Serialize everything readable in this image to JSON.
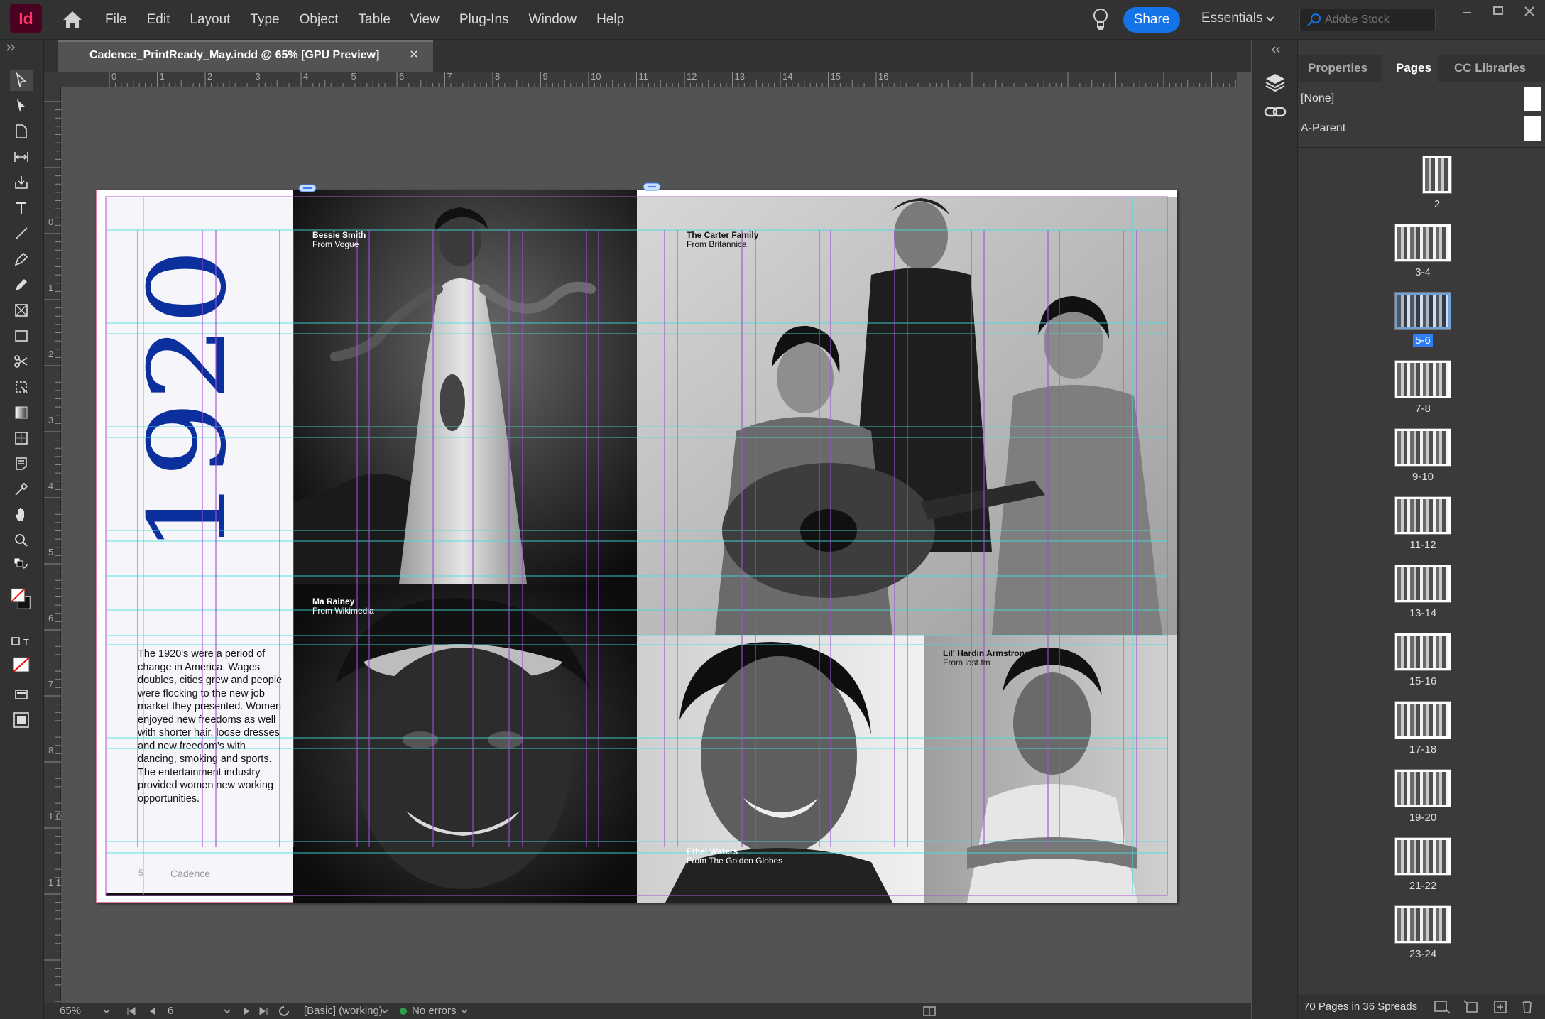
{
  "app": {
    "logo": "Id"
  },
  "menu": [
    "File",
    "Edit",
    "Layout",
    "Type",
    "Object",
    "Table",
    "View",
    "Plug-Ins",
    "Window",
    "Help"
  ],
  "share_label": "Share",
  "workspace_label": "Essentials",
  "stock_search": {
    "placeholder": "Adobe Stock"
  },
  "document": {
    "tab_title": "Cadence_PrintReady_May.indd @ 65% [GPU Preview]"
  },
  "ruler_labels": [
    "0",
    "1",
    "2",
    "3",
    "4",
    "5",
    "6",
    "7",
    "8",
    "9",
    "10",
    "11",
    "12",
    "13",
    "14",
    "15",
    "16"
  ],
  "ruler_v_labels": [
    "0",
    "1",
    "2",
    "3",
    "4",
    "5",
    "6",
    "7",
    "8",
    "1 0",
    "1 1"
  ],
  "spread": {
    "year": "1920",
    "intro": "The 1920's were a period of change in America. Wages doubles, cities grew and people were flocking to the new job market they presented. Women enjoyed new freedoms as well with shorter hair, loose dresses and new freedom's with dancing, smoking and sports. The entertainment industry provided women new working opportunities.",
    "footer_brand": "Cadence",
    "footer_page": "5",
    "credits": [
      {
        "name": "Bessie Smith",
        "source": "From Vogue"
      },
      {
        "name": "The Carter Family",
        "source": "From Britannica"
      },
      {
        "name": "Ma Rainey",
        "source": "From Wikimedia"
      },
      {
        "name": "Lil' Hardin Armstrong",
        "source": "From last.fm"
      },
      {
        "name": "Ethel Waters",
        "source": "From The Golden Globes"
      }
    ]
  },
  "status": {
    "zoom": "65%",
    "page": "6",
    "style": "[Basic] (working)",
    "errors": "No errors"
  },
  "panel": {
    "tabs": [
      "Properties",
      "Pages",
      "CC Libraries"
    ],
    "parents": [
      "[None]",
      "A-Parent"
    ],
    "spreads": [
      "2",
      "3-4",
      "5-6",
      "7-8",
      "9-10",
      "11-12",
      "13-14",
      "15-16",
      "17-18",
      "19-20",
      "21-22",
      "23-24"
    ],
    "selected_spread": "5-6",
    "footer": "70 Pages in 36 Spreads"
  },
  "colors": {
    "accent": "#1473e6",
    "year_blue": "#0b2f9c",
    "page_border": "#e07ba1",
    "guide_cyan": "#40e0e0",
    "guide_purple": "#a24fd0"
  }
}
